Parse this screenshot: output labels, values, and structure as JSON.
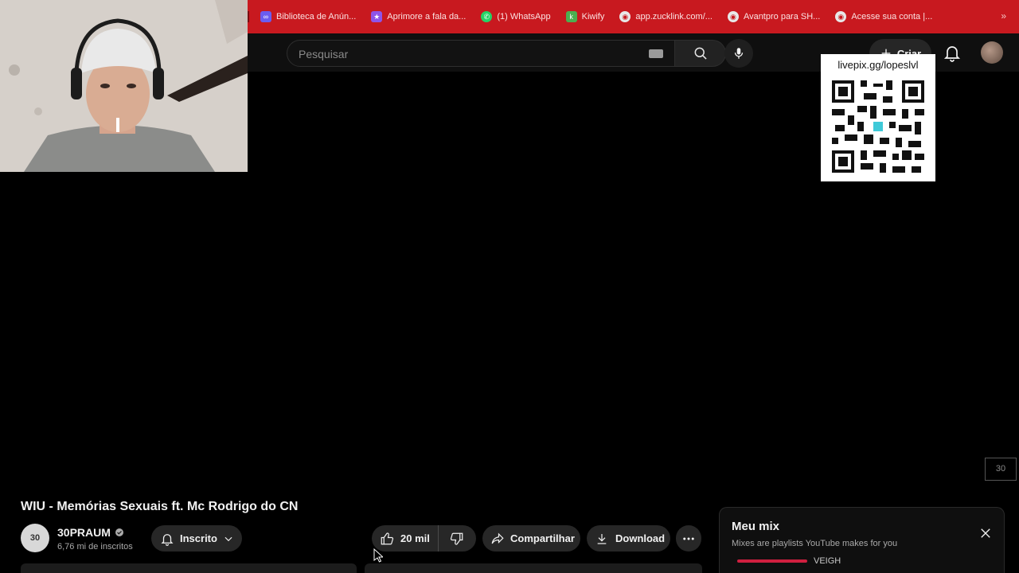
{
  "bookmarks": [
    {
      "label": "Biblioteca de Anún...",
      "icon": "meta-icon",
      "color": "#6a5df0"
    },
    {
      "label": "Aprimore a fala da...",
      "icon": "star-app-icon",
      "color": "#8e54e9"
    },
    {
      "label": "(1) WhatsApp",
      "icon": "whatsapp-icon",
      "color": "#25d366"
    },
    {
      "label": "Kiwify",
      "icon": "kiwify-icon",
      "color": "#4caf50"
    },
    {
      "label": "app.zucklink.com/...",
      "icon": "globe-icon",
      "color": "#e8e8e8"
    },
    {
      "label": "Avantpro para SH...",
      "icon": "globe-icon",
      "color": "#e8e8e8"
    },
    {
      "label": "Acesse sua conta |...",
      "icon": "globe-icon",
      "color": "#e8e8e8"
    }
  ],
  "bookmarks_more": "»",
  "search": {
    "placeholder": "Pesquisar"
  },
  "header": {
    "create_label": "Criar"
  },
  "overlay": {
    "qr_label": "livepix.gg/lopeslvl",
    "watermark": "30"
  },
  "video": {
    "title": "WIU - Memórias Sexuais ft. Mc Rodrigo do CN",
    "channel_name": "30PRAUM",
    "channel_avatar_text": "30",
    "subscribers": "6,76 mi de inscritos",
    "subscribe_label": "Inscrito",
    "likes": "20 mil",
    "share_label": "Compartilhar",
    "download_label": "Download"
  },
  "mix": {
    "title": "Meu mix",
    "subtitle": "Mixes are playlists YouTube makes for you",
    "first_item": "VEIGH"
  },
  "colors": {
    "bookmark_bar": "#c8191f",
    "background": "#0f0f0f",
    "accent": "#cf1f3f"
  }
}
